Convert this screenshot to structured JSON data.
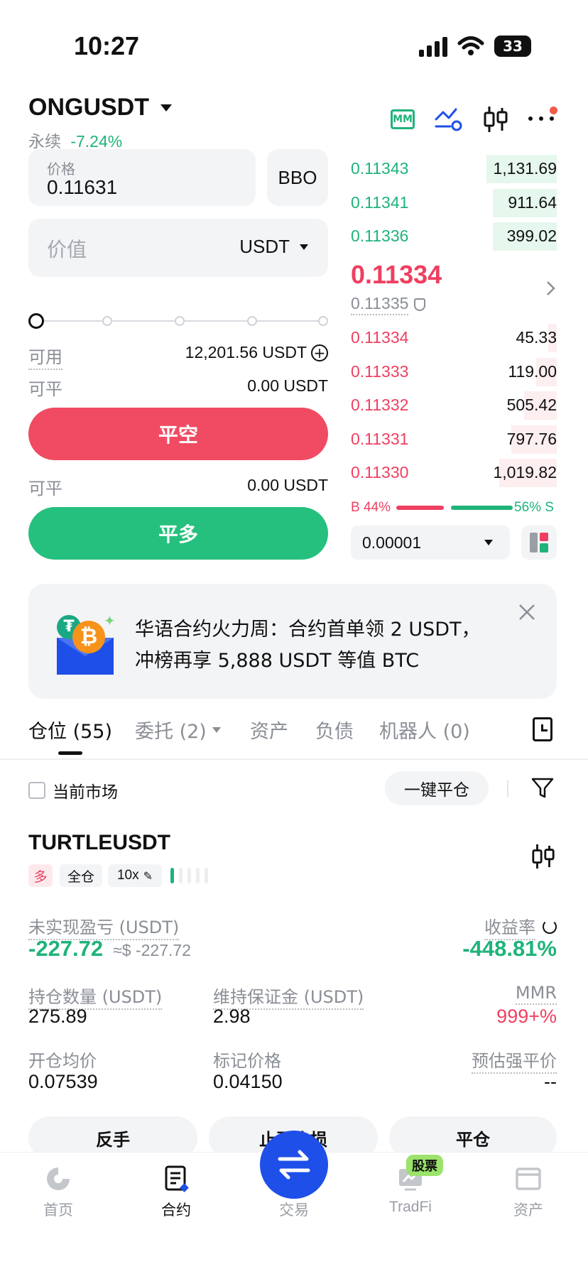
{
  "status_bar": {
    "time": "10:27",
    "battery": "33"
  },
  "header": {
    "pair": "ONGUSDT",
    "market_type": "永续",
    "change": "-7.24%",
    "mm_icon_text": "MM"
  },
  "order_form": {
    "price_label": "价格",
    "price_value": "0.11631",
    "bbo_label": "BBO",
    "value_placeholder": "价值",
    "value_unit": "USDT",
    "available_label": "可用",
    "available_value": "12,201.56 USDT",
    "closable_label_1": "可平",
    "closable_value_1": "0.00 USDT",
    "close_short_label": "平空",
    "closable_label_2": "可平",
    "closable_value_2": "0.00 USDT",
    "close_long_label": "平多",
    "slider_level": 0
  },
  "orderbook": {
    "asks": [
      {
        "price": "0.11343",
        "qty": "1,131.69",
        "depth": 0.34
      },
      {
        "price": "0.11341",
        "qty": "911.64",
        "depth": 0.31
      },
      {
        "price": "0.11336",
        "qty": "399.02",
        "depth": 0.31
      }
    ],
    "last_price": "0.11334",
    "mark_price": "0.11335",
    "bids": [
      {
        "price": "0.11334",
        "qty": "45.33",
        "depth": 0.04
      },
      {
        "price": "0.11333",
        "qty": "119.00",
        "depth": 0.1
      },
      {
        "price": "0.11332",
        "qty": "505.42",
        "depth": 0.16
      },
      {
        "price": "0.11331",
        "qty": "797.76",
        "depth": 0.22
      },
      {
        "price": "0.11330",
        "qty": "1,019.82",
        "depth": 0.28
      }
    ],
    "ratio_buy": "B 44%",
    "ratio_sell": "56% S",
    "buy_fraction": 0.44,
    "precision": "0.00001"
  },
  "banner": {
    "line1": "华语合约火力周：合约首单领 2 USDT，",
    "line2": "冲榜再享 5,888 USDT 等值 BTC"
  },
  "tabs": [
    {
      "label": "仓位 (55)",
      "active": true
    },
    {
      "label": "委托 (2)",
      "active": false
    },
    {
      "label": "资产",
      "active": false
    },
    {
      "label": "负债",
      "active": false
    },
    {
      "label": "机器人 (0)",
      "active": false
    }
  ],
  "filters": {
    "current_market_label": "当前市场",
    "close_all_label": "一键平仓"
  },
  "position": {
    "symbol": "TURTLEUSDT",
    "side_tag": "多",
    "margin_tag": "全仓",
    "leverage_tag": "10x",
    "pnl_label": "未实现盈亏 (USDT)",
    "pnl_value": "-227.72",
    "pnl_usd": "≈$ -227.72",
    "roe_label": "收益率",
    "roe_value": "-448.81%",
    "size_label": "持仓数量 (USDT)",
    "size_value": "275.89",
    "margin_label": "维持保证金 (USDT)",
    "margin_value": "2.98",
    "mmr_label": "MMR",
    "mmr_value": "999+%",
    "entry_label": "开仓均价",
    "entry_value": "0.07539",
    "mark_label": "标记价格",
    "mark_value": "0.04150",
    "liq_label": "预估强平价",
    "liq_value": "--",
    "btn_reverse": "反手",
    "btn_tpsl": "止盈止损",
    "btn_close": "平仓"
  },
  "bottom_nav": [
    {
      "label": "首页",
      "icon": "home-icon"
    },
    {
      "label": "合约",
      "icon": "futures-icon",
      "active": true
    },
    {
      "label": "交易",
      "icon": "swap-icon"
    },
    {
      "label": "TradFi",
      "icon": "tradfi-icon",
      "badge": "股票"
    },
    {
      "label": "资产",
      "icon": "wallet-icon"
    }
  ],
  "colors": {
    "green": "#1fb37a",
    "red": "#ef3f60",
    "blue": "#1e4fe8"
  }
}
